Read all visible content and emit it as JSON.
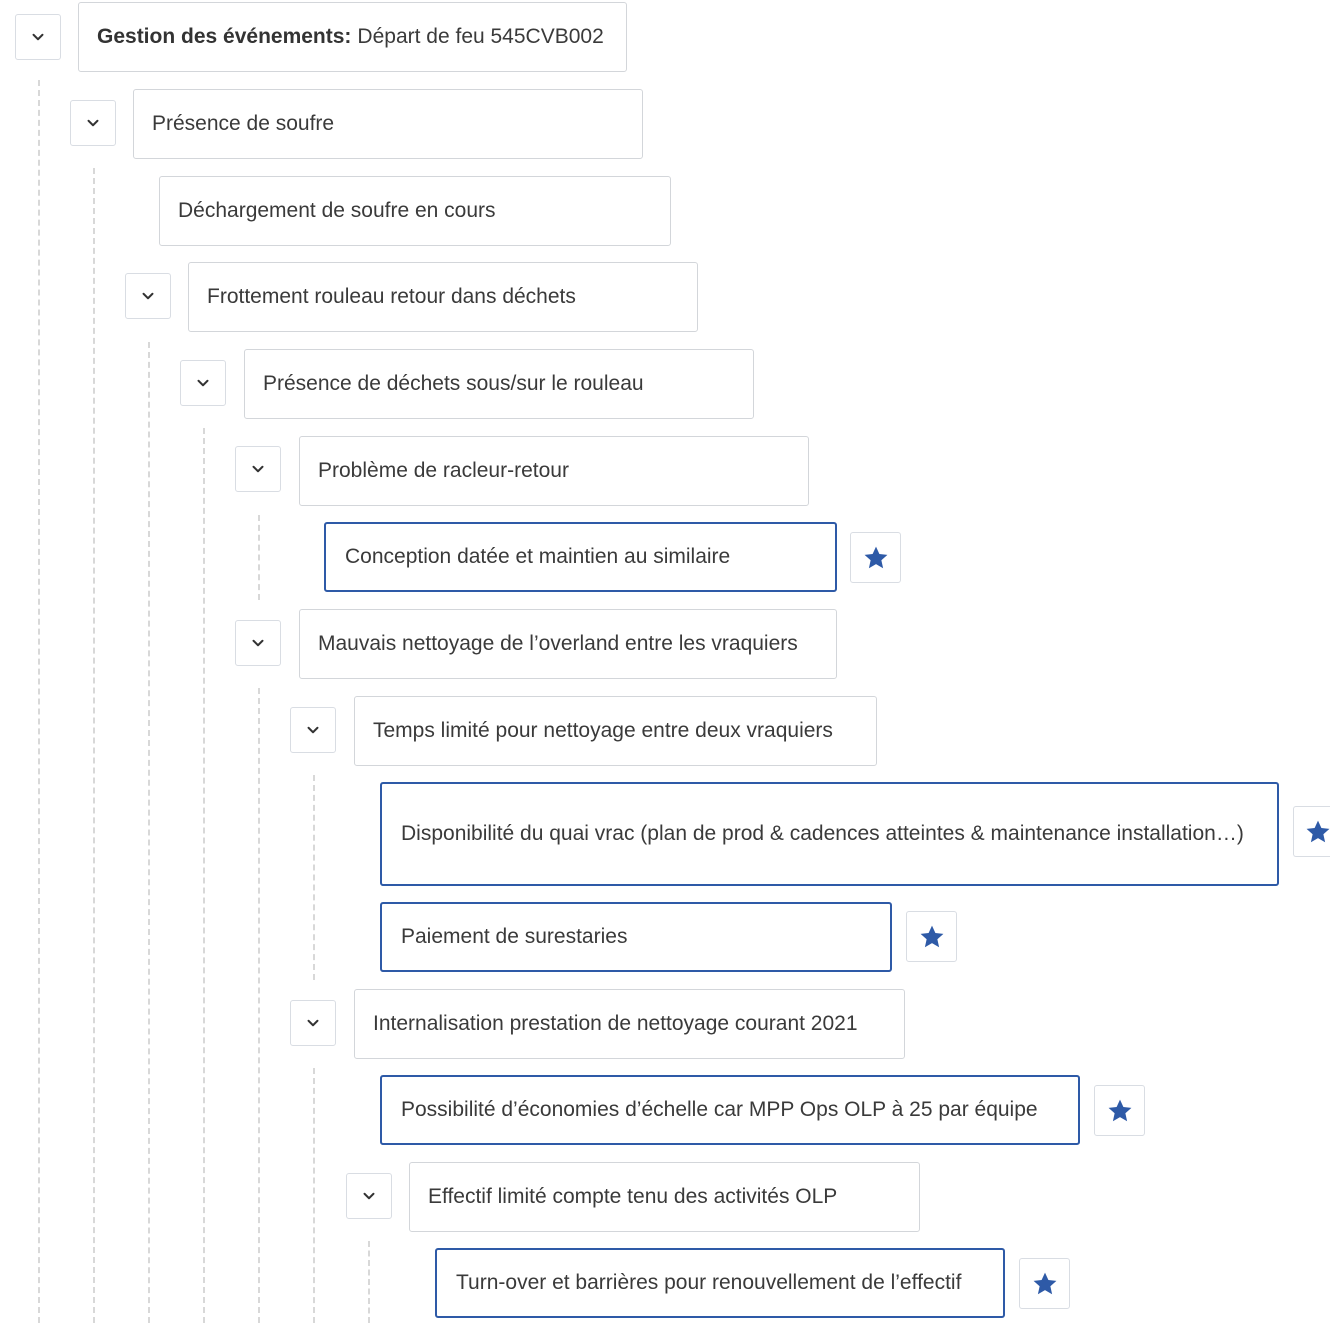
{
  "colors": {
    "accent": "#2e5aa7",
    "border": "#d3d6da",
    "dashed_line": "#d8d8d8",
    "text": "#3a3a3a"
  },
  "icons": {
    "toggle": "chevron-down-icon",
    "favorite": "star-icon"
  },
  "tree": {
    "root_label": "Gestion des événements:",
    "root_value": "Départ de feu 545CVB002",
    "nodes": [
      "Présence de soufre",
      "Déchargement de soufre en cours",
      "Frottement rouleau retour dans déchets",
      "Présence de déchets sous/sur le rouleau",
      "Problème de racleur-retour",
      "Conception datée et maintien au similaire",
      "Mauvais nettoyage de l’overland entre les vraquiers",
      "Temps limité pour nettoyage entre deux vraquiers",
      "Disponibilité du quai vrac (plan de prod & cadences atteintes & maintenance installation…)",
      "Paiement de surestaries",
      "Internalisation prestation de nettoyage courant 2021",
      "Possibilité d’économies d’échelle car MPP Ops OLP à 25 par équipe",
      "Effectif limité compte tenu des activités OLP",
      "Turn-over et barrières pour renouvellement de l’effectif"
    ]
  }
}
